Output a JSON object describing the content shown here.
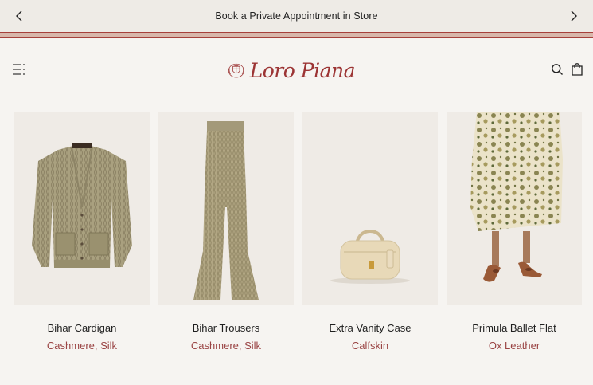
{
  "announcement": {
    "text": "Book a Private Appointment in Store",
    "prev_icon": "chevron-left-icon",
    "next_icon": "chevron-right-icon"
  },
  "header": {
    "brand": "Loro Piana",
    "menu_icon": "menu-icon",
    "search_icon": "search-icon",
    "bag_icon": "shopping-bag-icon"
  },
  "colors": {
    "brand_red": "#9c3434",
    "background": "#f6f4f1",
    "image_bg": "#efebe6"
  },
  "products": [
    {
      "name": "Bihar Cardigan",
      "material": "Cashmere, Silk"
    },
    {
      "name": "Bihar Trousers",
      "material": "Cashmere, Silk"
    },
    {
      "name": "Extra Vanity Case",
      "material": "Calfskin"
    },
    {
      "name": "Primula Ballet Flat",
      "material": "Ox Leather"
    }
  ]
}
